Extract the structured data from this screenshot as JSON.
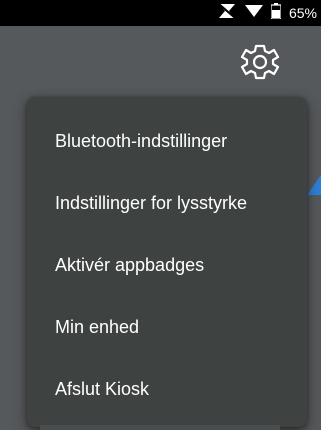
{
  "status_bar": {
    "battery_percent": "65%",
    "icons": [
      "no-sim-icon",
      "wifi-icon",
      "battery-icon"
    ]
  },
  "toolbar": {
    "settings_icon": "gear-icon"
  },
  "menu": {
    "items": [
      {
        "label": "Bluetooth-indstillinger"
      },
      {
        "label": "Indstillinger for lysstyrke"
      },
      {
        "label": "Aktivér appbadges"
      },
      {
        "label": "Min enhed"
      },
      {
        "label": "Afslut Kiosk"
      }
    ]
  },
  "colors": {
    "status_bar": "#000000",
    "background": "#56595c",
    "menu_background": "#3e4342",
    "menu_text": "#ffffff",
    "accent": "#2f7fd6"
  }
}
